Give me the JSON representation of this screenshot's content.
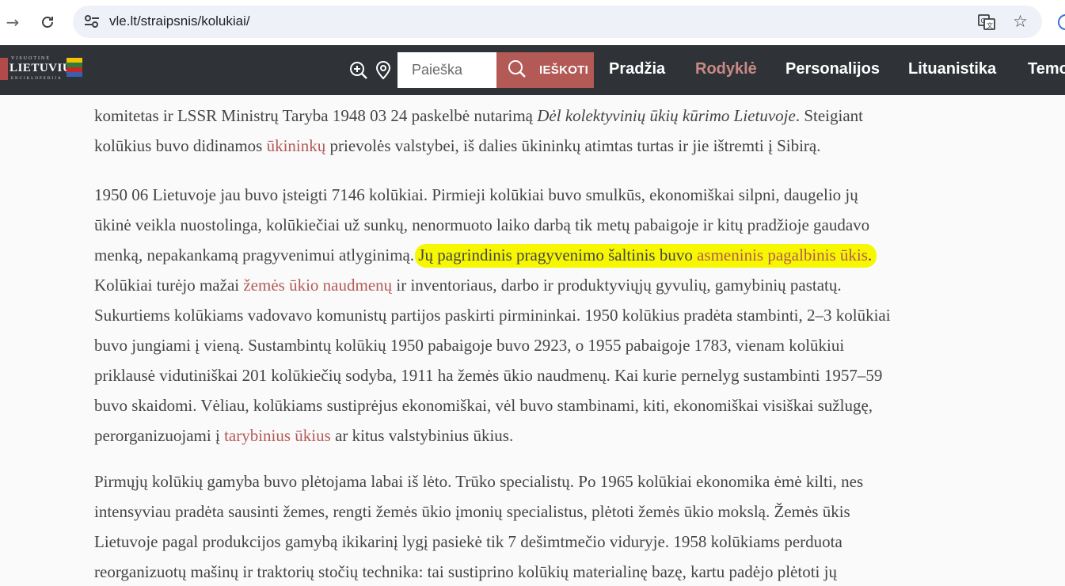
{
  "browser": {
    "url": "vle.lt/straipsnis/kolukiai/"
  },
  "site": {
    "logo": {
      "top": "VISUOTINĖ",
      "main": "LIETUVIŲ",
      "bottom": "ENCIKLOPEDIJA",
      "flag_colors": [
        "#f3c300",
        "#2f7d3a",
        "#c62828"
      ]
    },
    "search_placeholder": "Paieška",
    "search_button": "IEŠKOTI",
    "nav": [
      "Pradžia",
      "Rodyklė",
      "Personalijos",
      "Lituanistika",
      "Temos"
    ],
    "active_nav": "Rodyklė",
    "accent_color": "#b35a57",
    "highlight_color": "#f7f700"
  },
  "article": {
    "p1": {
      "l1a": "komitetas ir LSSR Ministrų Taryba 1948 03 24 paskelbė nutarimą ",
      "l1b": "Dėl kolektyvinių ūkių kūrimo Lietuvoje",
      "l1c": ". Steigiant",
      "l2a": "kolūkius buvo didinamos ",
      "l2link": "ūkininkų",
      "l2b": " prievolės valstybei, iš dalies ūkininkų atimtas turtas ir jie ištremti į Sibirą."
    },
    "p2": {
      "l1": "1950 06 Lietuvoje jau buvo įsteigti 7146 kolūkiai. Pirmieji kolūkiai buvo smulkūs, ekonomiškai silpni, daugelio jų",
      "l2": "ūkinė veikla nuostolinga, kolūkiečiai už sunkų, nenormuoto laiko darbą tik metų pabaigoje ir kitų pradžioje gaudavo",
      "l3a": "menką, nepakankamą pragyvenimui atlyginimą. ",
      "l3hl": "Jų pagrindinis pragyvenimo šaltinis buvo ",
      "l3link": "asmeninis pagalbinis ūkis",
      "l3end": ".",
      "l4a": "Kolūkiai turėjo mažai ",
      "l4link": "žemės ūkio naudmenų",
      "l4b": " ir inventoriaus, darbo ir produktyviųjų gyvulių, gamybinių pastatų.",
      "l5": "Sukurtiems kolūkiams vadovavo komunistų partijos paskirti pirmininkai. 1950 kolūkius pradėta stambinti, 2–3 kolūkiai",
      "l6": "buvo jungiami į vieną. Sustambintų kolūkių 1950 pabaigoje buvo 2923, o 1955 pabaigoje 1783, vienam kolūkiui",
      "l7": "priklausė vidutiniškai 201 kolūkiečių sodyba, 1911 ha žemės ūkio naudmenų. Kai kurie pernelyg sustambinti 1957–59",
      "l8": "buvo skaidomi. Vėliau, kolūkiams sustiprėjus ekonomiškai, vėl buvo stambinami, kiti, ekonomiškai visiškai sužlugę,",
      "l9a": "perorganizuojami į ",
      "l9link": "tarybinius ūkius",
      "l9b": " ar kitus valstybinius ūkius."
    },
    "p3": {
      "l1": "Pirmųjų kolūkių gamyba buvo plėtojama labai iš lėto. Trūko specialistų. Po 1965 kolūkiai ekonomika ėmė kilti, nes",
      "l2": "intensyviau pradėta sausinti žemes, rengti žemės ūkio įmonių specialistus, plėtoti žemės ūkio mokslą. Žemės ūkis",
      "l3": "Lietuvoje pagal produkcijos gamybą ikikarinį lygį pasiekė tik 7 dešimtmečio viduryje. 1958 kolūkiams perduota",
      "l4": "reorganizuotų mašinų ir traktorių stočių technika: tai sustiprino kolūkių materialinę bazę, kartu padėjo plėtoti jų"
    }
  }
}
